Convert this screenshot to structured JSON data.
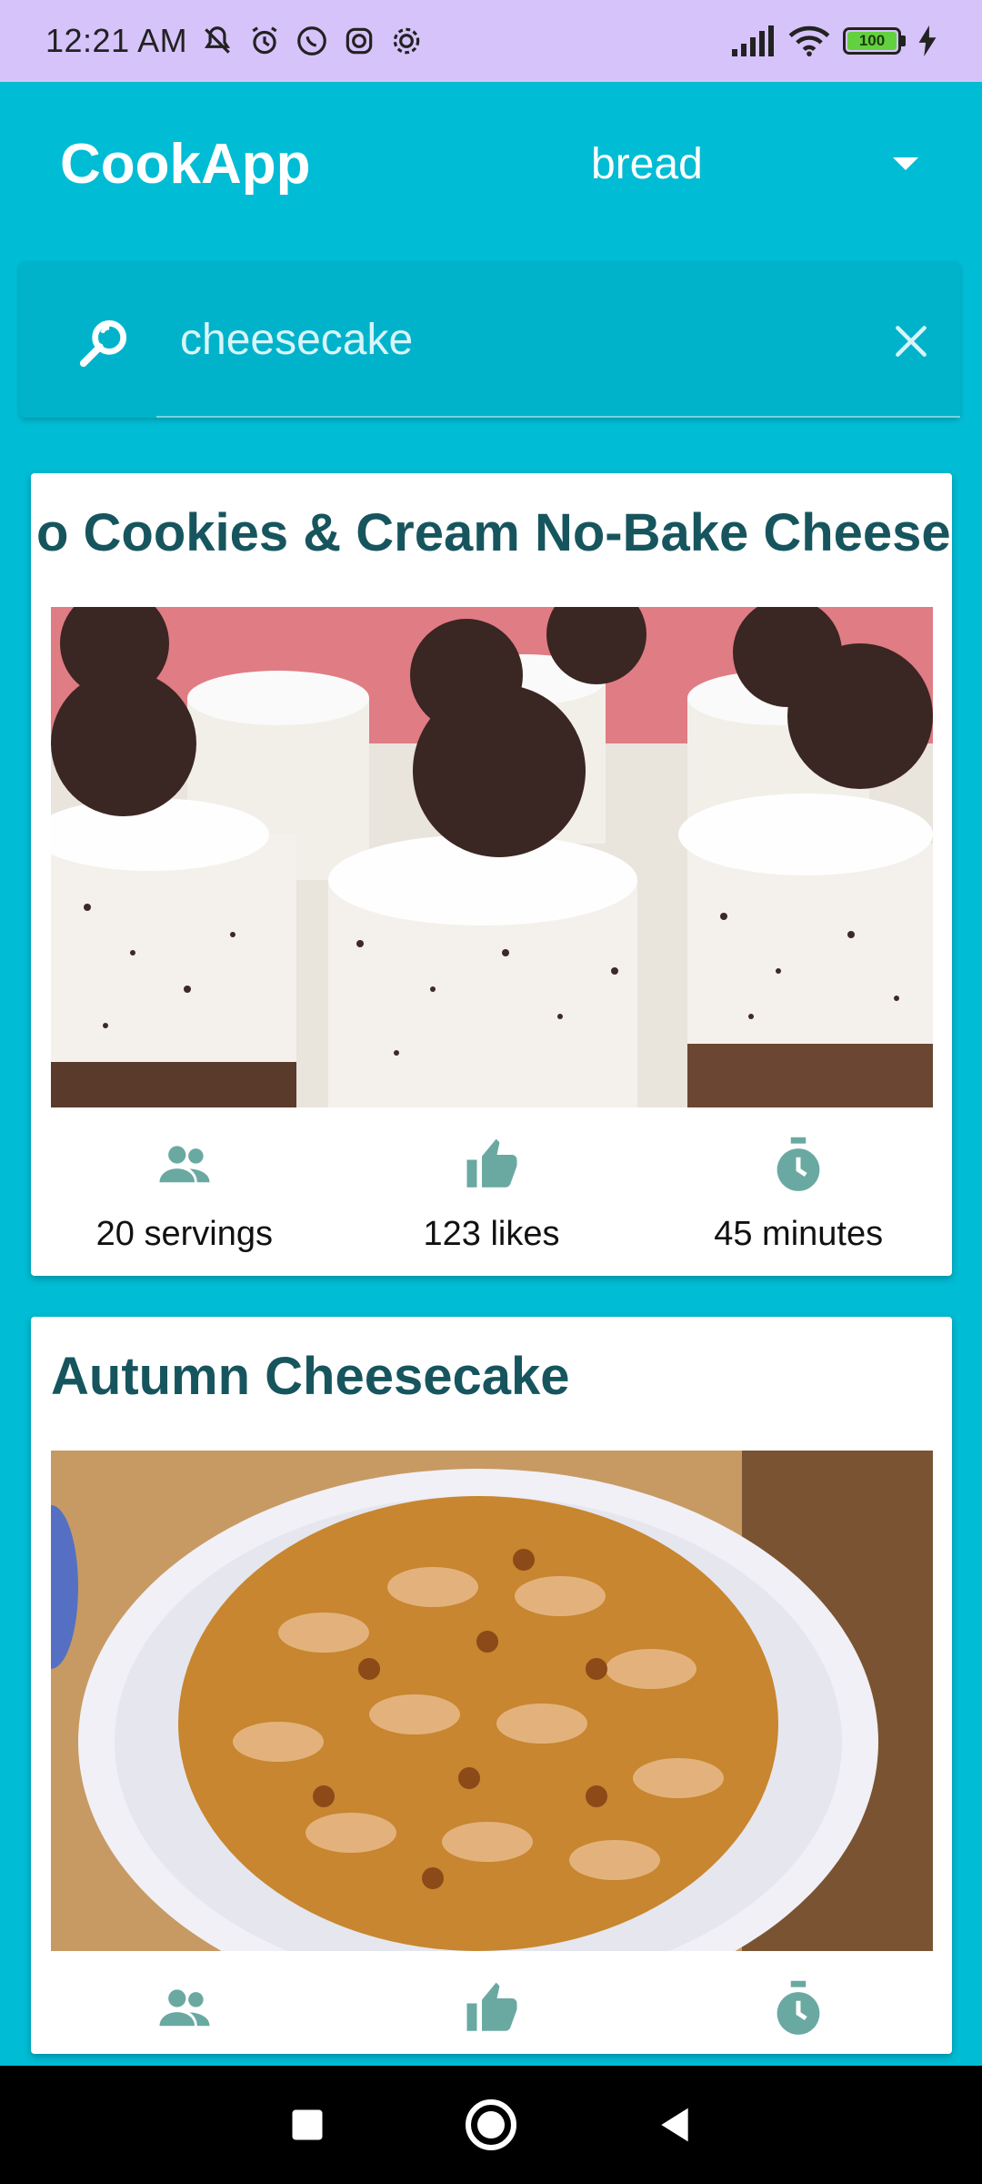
{
  "status_bar": {
    "time": "12:21 AM",
    "icons": [
      "mute-icon",
      "alarm-icon",
      "whatsapp-icon",
      "instagram-icon",
      "settings-gear-icon"
    ],
    "right_icons": [
      "signal-icon",
      "wifi-icon"
    ],
    "battery": "100",
    "charging_icon": "bolt-icon"
  },
  "app_bar": {
    "title": "CookApp",
    "category_dropdown": "bread"
  },
  "search": {
    "value": "cheesecake",
    "placeholder": ""
  },
  "recipes": [
    {
      "title": "o Cookies & Cream No-Bake Cheese",
      "servings": "20 servings",
      "likes": "123 likes",
      "time": "45 minutes"
    },
    {
      "title": "Autumn Cheesecake",
      "servings": "",
      "likes": "",
      "time": ""
    }
  ],
  "colors": {
    "status_bar": "#d6c3fa",
    "primary": "#00bcd4",
    "title_text": "#17555e",
    "stat_icon": "#6aa9a2"
  }
}
